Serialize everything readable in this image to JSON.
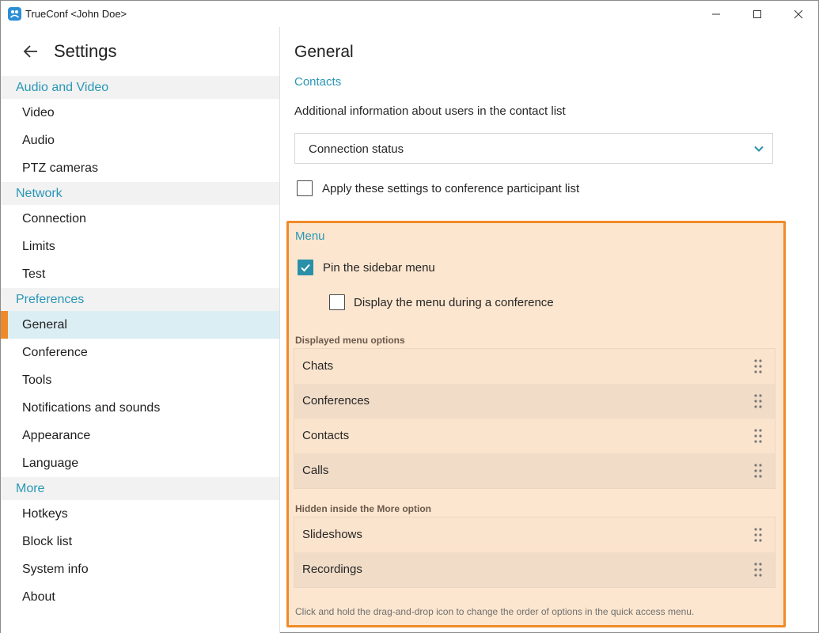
{
  "window": {
    "title": "TrueConf <John Doe>"
  },
  "sidebar": {
    "title": "Settings",
    "groups": [
      {
        "label": "Audio and Video",
        "items": [
          "Video",
          "Audio",
          "PTZ cameras"
        ]
      },
      {
        "label": "Network",
        "items": [
          "Connection",
          "Limits",
          "Test"
        ]
      },
      {
        "label": "Preferences",
        "items": [
          "General",
          "Conference",
          "Tools",
          "Notifications and sounds",
          "Appearance",
          "Language"
        ]
      },
      {
        "label": "More",
        "items": [
          "Hotkeys",
          "Block list",
          "System info",
          "About"
        ]
      }
    ],
    "active_item": "General"
  },
  "main": {
    "title": "General",
    "contacts_section": "Contacts",
    "contacts_description": "Additional information about users in the contact list",
    "contacts_select_value": "Connection status",
    "apply_to_participants_label": "Apply these settings to conference participant list",
    "apply_to_participants_checked": false
  },
  "menu": {
    "title": "Menu",
    "pin_sidebar_label": "Pin the sidebar menu",
    "pin_sidebar_checked": true,
    "display_during_conference_label": "Display the menu during a conference",
    "display_during_conference_checked": false,
    "displayed_heading": "Displayed menu options",
    "displayed_options": [
      "Chats",
      "Conferences",
      "Contacts",
      "Calls"
    ],
    "hidden_heading": "Hidden inside the More option",
    "hidden_options": [
      "Slideshows",
      "Recordings"
    ],
    "footnote": "Click and hold the drag-and-drop icon to change the order of options in the quick access menu."
  },
  "colors": {
    "accent": "#2a97b5",
    "highlight_border": "#f08a28",
    "highlight_fill": "#fde6cf",
    "checkbox_checked": "#2a8fa8"
  }
}
